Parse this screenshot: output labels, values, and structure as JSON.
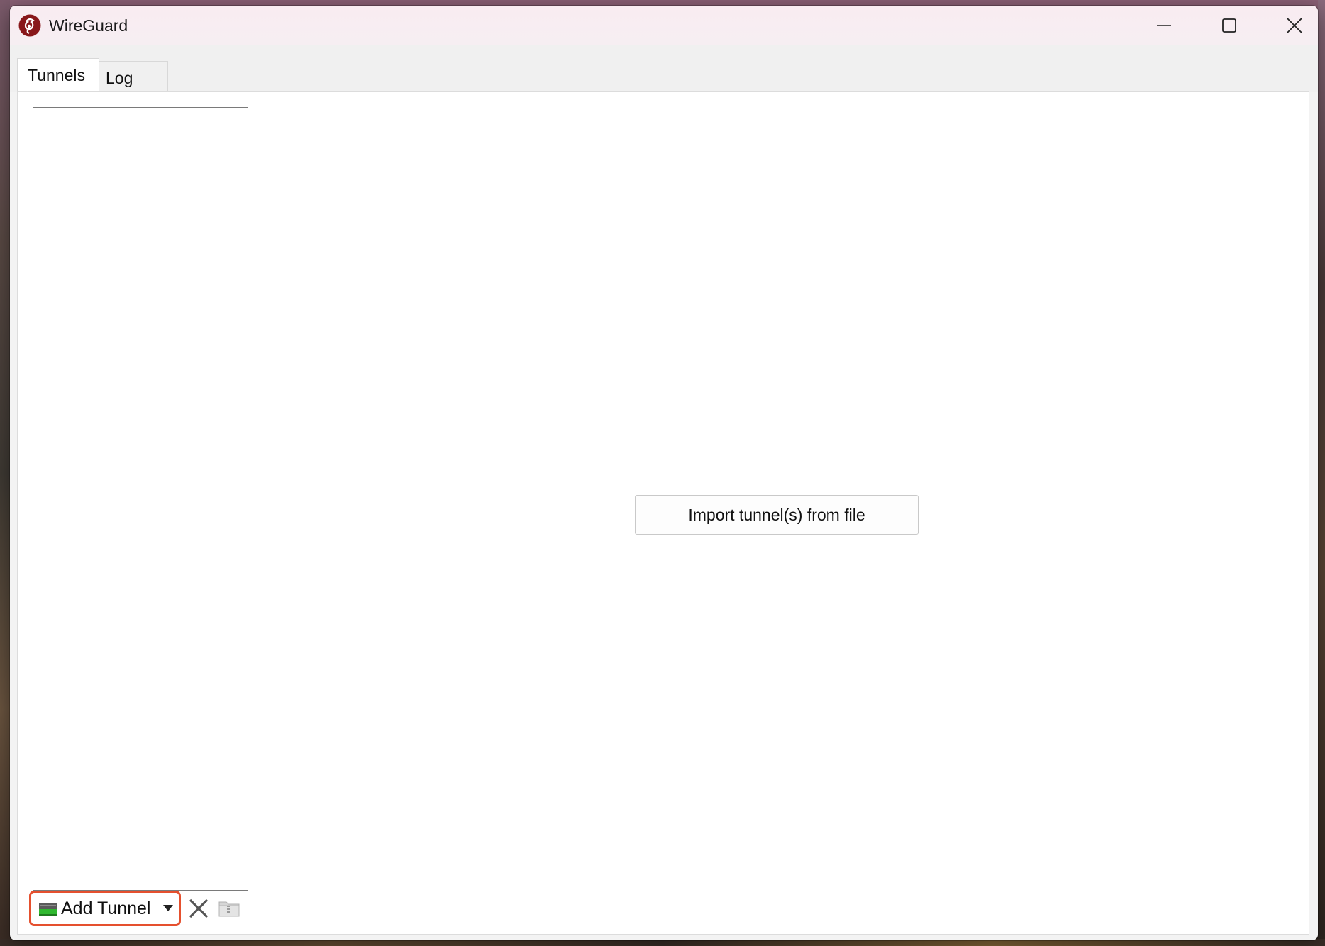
{
  "window": {
    "title": "WireGuard"
  },
  "tabs": [
    {
      "label": "Tunnels",
      "active": true
    },
    {
      "label": "Log",
      "active": false
    }
  ],
  "tunnel_list": {
    "items": []
  },
  "toolbar": {
    "add_tunnel_label": "Add Tunnel",
    "add_tunnel_icon": "network-adapter-icon",
    "dropdown_icon": "caret-down-icon",
    "delete_icon": "close-x-icon",
    "export_icon": "zip-folder-icon",
    "highlight_color": "#e5502e"
  },
  "main": {
    "import_button_label": "Import tunnel(s) from file"
  },
  "colors": {
    "brand": "#88171a",
    "titlebar": "#f8edf2"
  }
}
